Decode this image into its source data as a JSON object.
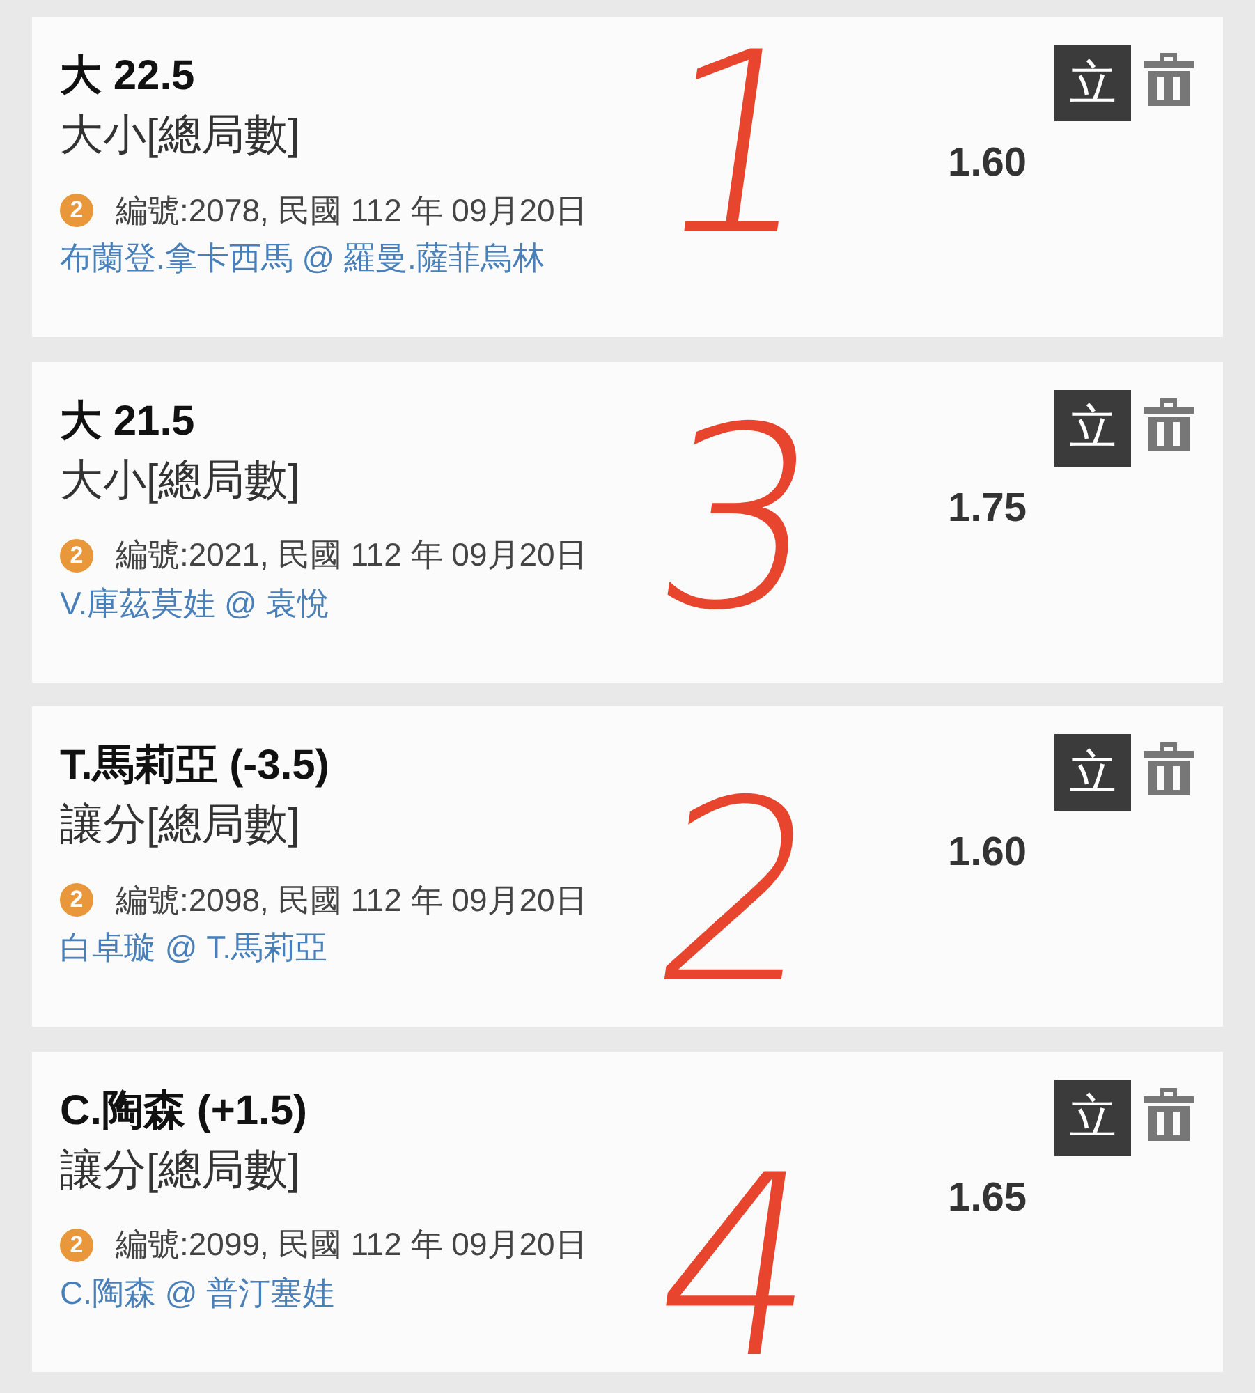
{
  "bets": [
    {
      "selection": "大 22.5",
      "market": "大小[總局數]",
      "badge": "2",
      "info": "編號:2078, 民國 112 年 09月20日",
      "match": "布蘭登.拿卡西馬 @ 羅曼.薩菲烏林",
      "odds": "1.60",
      "action": "立",
      "annotation": "1"
    },
    {
      "selection": "大 21.5",
      "market": "大小[總局數]",
      "badge": "2",
      "info": "編號:2021, 民國 112 年 09月20日",
      "match": "V.庫茲莫娃 @ 袁悅",
      "odds": "1.75",
      "action": "立",
      "annotation": "3"
    },
    {
      "selection": "T.馬莉亞 (-3.5)",
      "market": "讓分[總局數]",
      "badge": "2",
      "info": "編號:2098, 民國 112 年 09月20日",
      "match": "白卓璇 @ T.馬莉亞",
      "odds": "1.60",
      "action": "立",
      "annotation": "2"
    },
    {
      "selection": "C.陶森 (+1.5)",
      "market": "讓分[總局數]",
      "badge": "2",
      "info": "編號:2099, 民國 112 年 09月20日",
      "match": "C.陶森 @ 普汀塞娃",
      "odds": "1.65",
      "action": "立",
      "annotation": "4"
    }
  ]
}
